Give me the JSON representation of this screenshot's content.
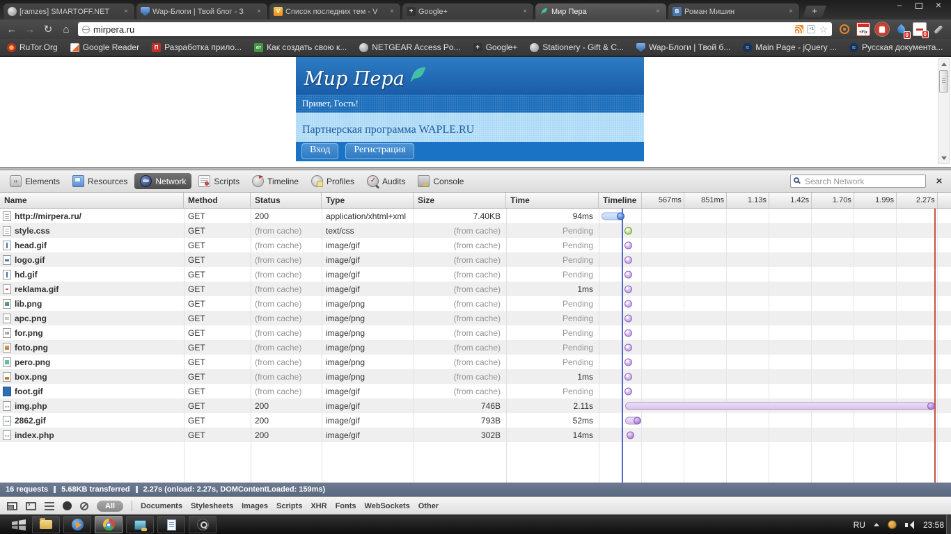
{
  "browser": {
    "tabs": [
      {
        "title": "[ramzes] SMARTOFF.NET",
        "icon": "globe-icon",
        "active": false
      },
      {
        "title": "Wap-Блоги | Твой блог - З",
        "icon": "shield-icon",
        "active": false
      },
      {
        "title": "Список последних тем - V",
        "icon": "v-icon",
        "active": false
      },
      {
        "title": "Google+",
        "icon": "gplus-icon",
        "active": false
      },
      {
        "title": "Мир Пера",
        "icon": "feather-icon",
        "active": true
      },
      {
        "title": "Роман Мишин",
        "icon": "vk-icon",
        "active": false
      }
    ],
    "url": "mirpera.ru",
    "extensions": [
      {
        "icon": "radar-icon",
        "badge": ""
      },
      {
        "icon": "fix-icon",
        "badge": ""
      },
      {
        "icon": "stop-icon",
        "badge": ""
      },
      {
        "icon": "drop-icon",
        "badge": "0"
      },
      {
        "icon": "minus-icon",
        "badge": "0"
      },
      {
        "icon": "wrench-icon",
        "badge": ""
      }
    ],
    "bookmarks": [
      {
        "label": "RuTor.Org",
        "icon": "rutor-icon"
      },
      {
        "label": "Google Reader",
        "icon": "greader-icon"
      },
      {
        "label": "Разработка прило...",
        "icon": "p-icon"
      },
      {
        "label": "Как создать свою к...",
        "icon": "at-icon"
      },
      {
        "label": "NETGEAR Access Po...",
        "icon": "globe-icon"
      },
      {
        "label": "Google+",
        "icon": "gplus-icon"
      },
      {
        "label": "Stationery - Gift & C...",
        "icon": "globe-icon"
      },
      {
        "label": "Wap-Блоги | Твой б...",
        "icon": "shield-icon"
      },
      {
        "label": "Main Page - jQuery ...",
        "icon": "jquery-icon"
      },
      {
        "label": "Русская документа...",
        "icon": "jquery-icon"
      }
    ]
  },
  "page": {
    "logo_text": "Мир Пера",
    "greeting": "Привет, Гость!",
    "partner": "Партнерская программа WAPLE.RU",
    "login_label": "Вход",
    "register_label": "Регистрация"
  },
  "devtools": {
    "tabs": [
      {
        "label": "Elements",
        "icon": "elements-icon",
        "active": false
      },
      {
        "label": "Resources",
        "icon": "resources-icon",
        "active": false
      },
      {
        "label": "Network",
        "icon": "network-icon",
        "active": true
      },
      {
        "label": "Scripts",
        "icon": "scripts-icon",
        "active": false
      },
      {
        "label": "Timeline",
        "icon": "timeline-icon",
        "active": false
      },
      {
        "label": "Profiles",
        "icon": "profiles-icon",
        "active": false
      },
      {
        "label": "Audits",
        "icon": "audits-icon",
        "active": false
      },
      {
        "label": "Console",
        "icon": "console-icon",
        "active": false
      }
    ],
    "search_placeholder": "Search Network",
    "columns": [
      "Name",
      "Method",
      "Status",
      "Type",
      "Size",
      "Time",
      "Timeline"
    ],
    "timeline_meta": {
      "gridlines_pct": [
        12.0,
        24.1,
        36.2,
        48.2,
        60.3,
        72.3,
        84.4,
        96.0
      ],
      "ticks": [
        {
          "label": "567ms",
          "pct": 24.1
        },
        {
          "label": "851ms",
          "pct": 36.2
        },
        {
          "label": "1.13s",
          "pct": 48.2
        },
        {
          "label": "1.42s",
          "pct": 60.3
        },
        {
          "label": "1.70s",
          "pct": 72.3
        },
        {
          "label": "1.99s",
          "pct": 84.4
        },
        {
          "label": "2.27s",
          "pct": 96.0
        }
      ],
      "dcl_line_pct": 6.6,
      "load_line_pct": 95.3
    },
    "rows": [
      {
        "icon": "doc",
        "name": "http://mirpera.ru/",
        "method": "GET",
        "status": "200",
        "type": "application/xhtml+xml",
        "size": "7.40KB",
        "time": "94ms",
        "timeline": {
          "shape": "bar",
          "color": "blue",
          "left_pct": 0.8,
          "width_pct": 6.4
        }
      },
      {
        "icon": "doc",
        "name": "style.css",
        "method": "GET",
        "status": "(from cache)",
        "type": "text/css",
        "size": "(from cache)",
        "time": "Pending",
        "timeline": {
          "shape": "dot",
          "color": "green",
          "left_pct": 8.3
        }
      },
      {
        "icon": "vline",
        "name": "head.gif",
        "method": "GET",
        "status": "(from cache)",
        "type": "image/gif",
        "size": "(from cache)",
        "time": "Pending",
        "timeline": {
          "shape": "dot",
          "color": "purple",
          "left_pct": 8.3
        }
      },
      {
        "icon": "hblue",
        "name": "logo.gif",
        "method": "GET",
        "status": "(from cache)",
        "type": "image/gif",
        "size": "(from cache)",
        "time": "Pending",
        "timeline": {
          "shape": "dot",
          "color": "purple",
          "left_pct": 8.3
        }
      },
      {
        "icon": "vline",
        "name": "hd.gif",
        "method": "GET",
        "status": "(from cache)",
        "type": "image/gif",
        "size": "(from cache)",
        "time": "Pending",
        "timeline": {
          "shape": "dot",
          "color": "purple",
          "left_pct": 8.3
        }
      },
      {
        "icon": "hred",
        "name": "reklama.gif",
        "method": "GET",
        "status": "(from cache)",
        "type": "image/gif",
        "size": "(from cache)",
        "time": "1ms",
        "timeline": {
          "shape": "dot",
          "color": "purple",
          "left_pct": 8.3
        }
      },
      {
        "icon": "green",
        "name": "lib.png",
        "method": "GET",
        "status": "(from cache)",
        "type": "image/png",
        "size": "(from cache)",
        "time": "Pending",
        "timeline": {
          "shape": "dot",
          "color": "purple",
          "left_pct": 8.3
        }
      },
      {
        "icon": "gray",
        "name": "apc.png",
        "method": "GET",
        "status": "(from cache)",
        "type": "image/png",
        "size": "(from cache)",
        "time": "Pending",
        "timeline": {
          "shape": "dot",
          "color": "purple",
          "left_pct": 8.3
        }
      },
      {
        "icon": "arrow",
        "name": "for.png",
        "method": "GET",
        "status": "(from cache)",
        "type": "image/png",
        "size": "(from cache)",
        "time": "Pending",
        "timeline": {
          "shape": "dot",
          "color": "purple",
          "left_pct": 8.3
        }
      },
      {
        "icon": "orange",
        "name": "foto.png",
        "method": "GET",
        "status": "(from cache)",
        "type": "image/png",
        "size": "(from cache)",
        "time": "Pending",
        "timeline": {
          "shape": "dot",
          "color": "purple",
          "left_pct": 8.3
        }
      },
      {
        "icon": "feather",
        "name": "pero.png",
        "method": "GET",
        "status": "(from cache)",
        "type": "image/png",
        "size": "(from cache)",
        "time": "Pending",
        "timeline": {
          "shape": "dot",
          "color": "purple",
          "left_pct": 8.3
        }
      },
      {
        "icon": "box",
        "name": "box.png",
        "method": "GET",
        "status": "(from cache)",
        "type": "image/png",
        "size": "(from cache)",
        "time": "1ms",
        "timeline": {
          "shape": "dot",
          "color": "purple",
          "left_pct": 8.3
        }
      },
      {
        "icon": "solid",
        "name": "foot.gif",
        "method": "GET",
        "status": "(from cache)",
        "type": "image/gif",
        "size": "(from cache)",
        "time": "Pending",
        "timeline": {
          "shape": "dot",
          "color": "purple",
          "left_pct": 8.3
        }
      },
      {
        "icon": "dotspurple",
        "name": "img.php",
        "method": "GET",
        "status": "200",
        "type": "image/gif",
        "size": "746B",
        "time": "2.11s",
        "timeline": {
          "shape": "bar",
          "color": "purple",
          "left_pct": 7.5,
          "width_pct": 87.8
        }
      },
      {
        "icon": "dotsblue",
        "name": "2862.gif",
        "method": "GET",
        "status": "200",
        "type": "image/gif",
        "size": "793B",
        "time": "52ms",
        "timeline": {
          "shape": "bar",
          "color": "purple",
          "left_pct": 7.5,
          "width_pct": 4.4
        }
      },
      {
        "icon": "dotsgray",
        "name": "index.php",
        "method": "GET",
        "status": "200",
        "type": "image/gif",
        "size": "302B",
        "time": "14ms",
        "timeline": {
          "shape": "soliddot",
          "color": "purple",
          "left_pct": 8.8
        }
      }
    ],
    "status_parts": [
      "16 requests",
      "5.68KB transferred",
      "2.27s (onload: 2.27s, DOMContentLoaded: 159ms)"
    ],
    "filters": [
      {
        "label": "All",
        "selected": true
      },
      {
        "label": "Documents",
        "selected": false
      },
      {
        "label": "Stylesheets",
        "selected": false
      },
      {
        "label": "Images",
        "selected": false
      },
      {
        "label": "Scripts",
        "selected": false
      },
      {
        "label": "XHR",
        "selected": false
      },
      {
        "label": "Fonts",
        "selected": false
      },
      {
        "label": "WebSockets",
        "selected": false
      },
      {
        "label": "Other",
        "selected": false
      }
    ]
  },
  "taskbar": {
    "apps": [
      {
        "icon": "folder-icon",
        "active": false
      },
      {
        "icon": "media-player-icon",
        "active": false
      },
      {
        "icon": "chrome-icon",
        "active": true
      },
      {
        "icon": "remote-icon",
        "active": false
      },
      {
        "icon": "notepad-icon",
        "active": false
      },
      {
        "icon": "tb-search-icon",
        "active": false
      }
    ],
    "lang": "RU",
    "time": "23:58"
  },
  "colors": {
    "accent_blue_line": "#5565c8",
    "accent_red_line": "#cc4f43",
    "dot_purple": "#b48cd8",
    "dot_green": "#93cd5a",
    "bar_blue": "#b9d2f2",
    "site_blue": "#1a73c4"
  }
}
